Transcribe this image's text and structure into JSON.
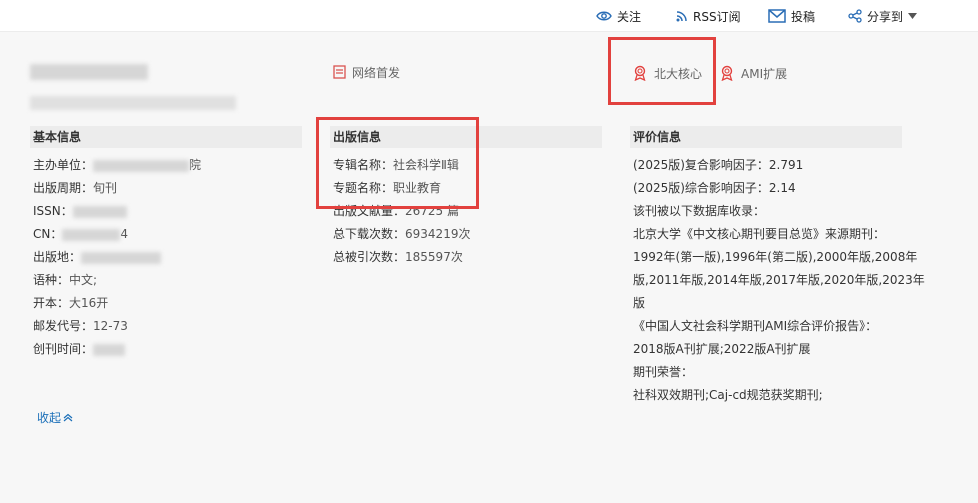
{
  "toolbar": {
    "follow": "关注",
    "rss": "RSS订阅",
    "submit": "投稿",
    "share": "分享到"
  },
  "badges": {
    "network_first": "网络首发",
    "pku_core": "北大核心",
    "ami_ext": "AMI扩展"
  },
  "basic": {
    "title": "基本信息",
    "rows": [
      {
        "k": "主办单位：",
        "v": "院"
      },
      {
        "k": "出版周期：",
        "v": "旬刊"
      },
      {
        "k": "ISSN：",
        "v": ""
      },
      {
        "k": "CN：",
        "v": "4"
      },
      {
        "k": "出版地：",
        "v": ""
      },
      {
        "k": "语种：",
        "v": "中文;"
      },
      {
        "k": "开本：",
        "v": "大16开"
      },
      {
        "k": "邮发代号：",
        "v": "12-73"
      },
      {
        "k": "创刊时间：",
        "v": ""
      }
    ]
  },
  "pub": {
    "title": "出版信息",
    "rows": [
      {
        "k": "专辑名称：",
        "v": "社会科学Ⅱ辑"
      },
      {
        "k": "专题名称：",
        "v": "职业教育"
      },
      {
        "k": "出版文献量：",
        "v": "26725 篇"
      },
      {
        "k": "总下载次数：",
        "v": "6934219次"
      },
      {
        "k": "总被引次数：",
        "v": "185597次"
      }
    ]
  },
  "eval": {
    "title": "评价信息",
    "lines": [
      "(2025版)复合影响因子：2.791",
      "(2025版)综合影响因子：2.14",
      "该刊被以下数据库收录：",
      "北京大学《中文核心期刊要目总览》来源期刊：",
      "1992年(第一版),1996年(第二版),2000年版,2008年",
      "版,2011年版,2014年版,2017年版,2020年版,2023年",
      "版",
      "《中国人文社会科学期刊AMI综合评价报告》：",
      "2018版A刊扩展;2022版A刊扩展",
      "期刊荣誉：",
      "社科双效期刊;Caj-cd规范获奖期刊;"
    ]
  },
  "collapse": "收起"
}
